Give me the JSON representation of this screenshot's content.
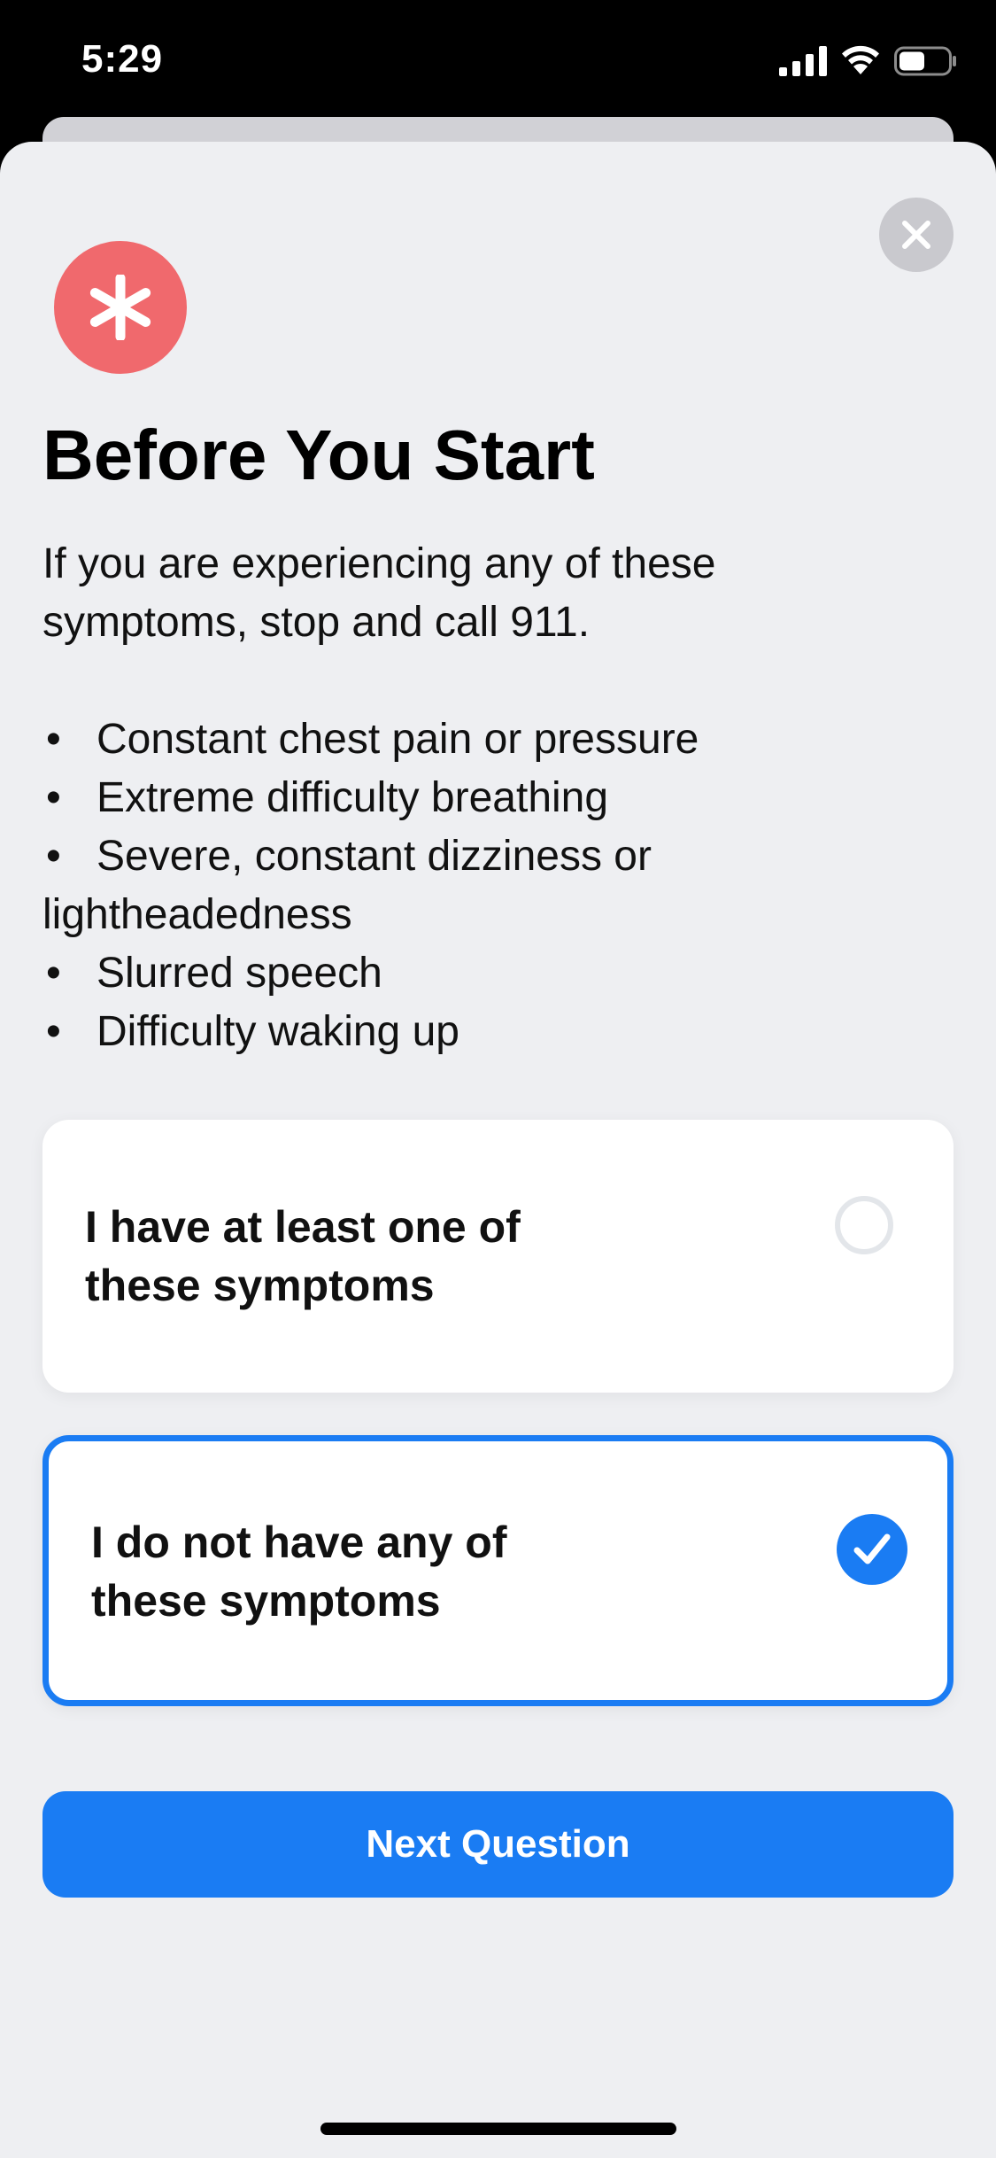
{
  "status_bar": {
    "time": "5:29"
  },
  "icons": {
    "close": "close-icon",
    "hero": "asterisk-icon",
    "signal": "cellular-signal-icon",
    "wifi": "wifi-icon",
    "battery": "battery-icon",
    "check": "checkmark-icon"
  },
  "page": {
    "title": "Before You Start",
    "intro": "If you are experiencing any of these symptoms, stop and call 911.",
    "symptoms": [
      "Constant chest pain or pressure",
      "Extreme difficulty breathing",
      "Severe, constant dizziness or lightheadedness",
      "Slurred speech",
      "Difficulty waking up"
    ],
    "bullet": "•"
  },
  "options": [
    {
      "line1": "I have at least one of",
      "line2": "these symptoms",
      "selected": false
    },
    {
      "line1": "I do not have any of",
      "line2": "these symptoms",
      "selected": true
    }
  ],
  "actions": {
    "next_label": "Next Question"
  },
  "colors": {
    "accent": "#1a7cf3",
    "hero_icon_bg": "#f0696d",
    "sheet_bg": "#eeeff2",
    "close_bg": "#c9c9ce"
  }
}
